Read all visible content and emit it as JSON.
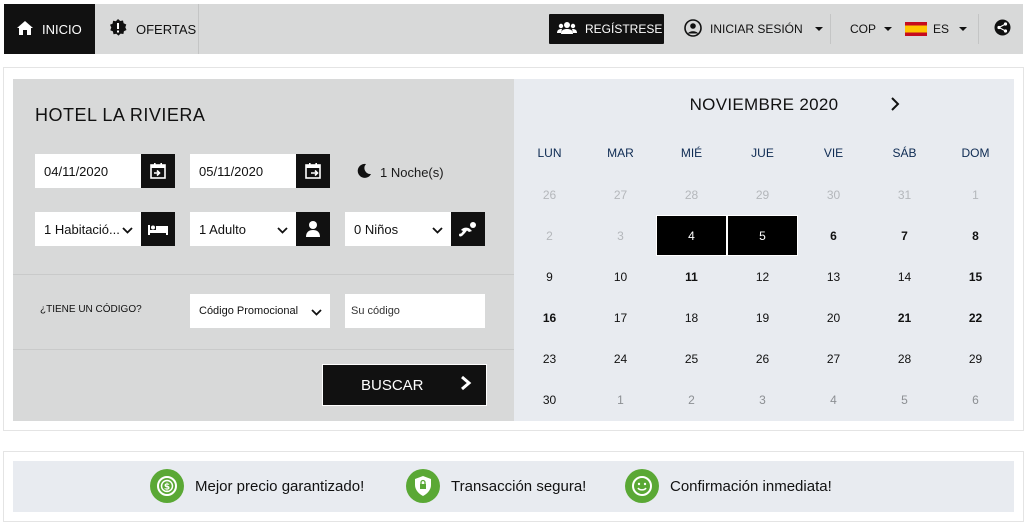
{
  "nav": {
    "home": "INICIO",
    "offers": "OFERTAS",
    "register": "REGÍSTRESE",
    "login": "INICIAR SESIÓN",
    "currency": "COP",
    "language": "ES"
  },
  "booking": {
    "hotel_name": "HOTEL LA RIVIERA",
    "checkin": "04/11/2020",
    "checkout": "05/11/2020",
    "nights": "1 Noche(s)",
    "rooms": "1 Habitació...",
    "adults": "1 Adulto",
    "children": "0 Niños",
    "promo_question": "¿TIENE UN CÓDIGO?",
    "promo_type": "Código Promocional",
    "promo_code_placeholder": "Su código",
    "search": "BUSCAR"
  },
  "calendar": {
    "month_title": "NOVIEMBRE 2020",
    "weekdays": [
      "LUN",
      "MAR",
      "MIÉ",
      "JUE",
      "VIE",
      "SÁB",
      "DOM"
    ],
    "weeks": [
      [
        "26",
        "27",
        "28",
        "29",
        "30",
        "31",
        "1"
      ],
      [
        "2",
        "3",
        "4",
        "5",
        "6",
        "7",
        "8"
      ],
      [
        "9",
        "10",
        "11",
        "12",
        "13",
        "14",
        "15"
      ],
      [
        "16",
        "17",
        "18",
        "19",
        "20",
        "21",
        "22"
      ],
      [
        "23",
        "24",
        "25",
        "26",
        "27",
        "28",
        "29"
      ],
      [
        "30",
        "1",
        "2",
        "3",
        "4",
        "5",
        "6"
      ]
    ],
    "selected_start": "4",
    "selected_end": "5"
  },
  "features": {
    "best_price": "Mejor precio garantizado!",
    "secure": "Transacción segura!",
    "confirmation": "Confirmación inmediata!"
  },
  "colors": {
    "accent": "#111111",
    "nav_bg": "#d8d9d9",
    "calendar_bg": "#e8ebf0",
    "feature_icon": "#5aa835",
    "weekday_text": "#0d2a52"
  }
}
